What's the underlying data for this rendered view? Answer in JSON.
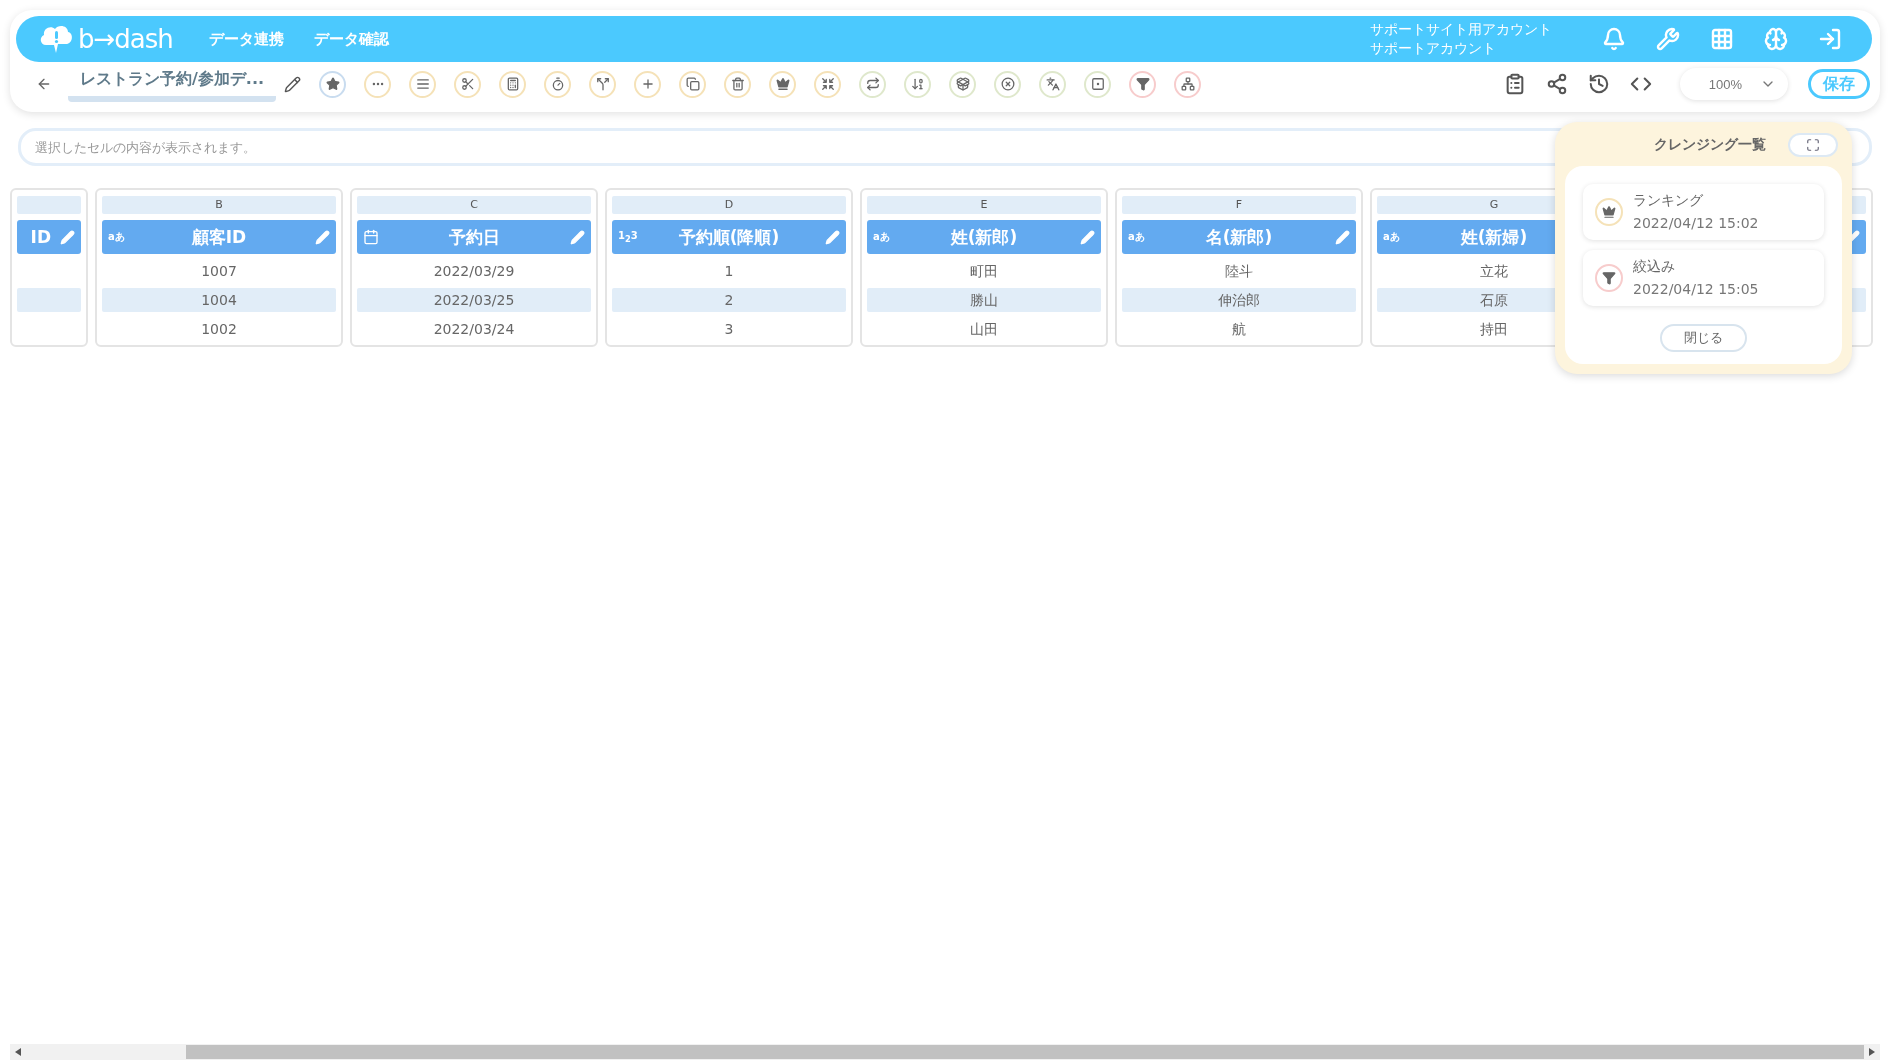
{
  "header": {
    "logo": "b→dash",
    "nav": [
      "データ連携",
      "データ確認"
    ],
    "account": {
      "site": "サポートサイト用アカウント",
      "name": "サポートアカウント"
    },
    "icons": [
      {
        "kind": "bell"
      },
      {
        "kind": "wrench"
      },
      {
        "kind": "grid"
      },
      {
        "kind": "mascot"
      },
      {
        "kind": "logout"
      }
    ]
  },
  "toolbar": {
    "title": "レストラン予約/参加デ...",
    "tools": [
      {
        "kind": "star",
        "color": "#c9dcef"
      },
      {
        "kind": "dots",
        "color": "#f5e2b8"
      },
      {
        "kind": "lines",
        "color": "#f5e2b8"
      },
      {
        "kind": "scissors",
        "color": "#f5e2b8"
      },
      {
        "kind": "calc",
        "color": "#f5e2b8"
      },
      {
        "kind": "timer",
        "color": "#f5e2b8"
      },
      {
        "kind": "split",
        "color": "#f5e2b8"
      },
      {
        "kind": "plus",
        "color": "#f5e2b8"
      },
      {
        "kind": "copy",
        "color": "#f5e2b8"
      },
      {
        "kind": "trash",
        "color": "#f5e2b8"
      },
      {
        "kind": "crown",
        "color": "#f5e2b8"
      },
      {
        "kind": "shrink",
        "color": "#f5e2b8"
      },
      {
        "kind": "repeat",
        "color": "#dfe8cc"
      },
      {
        "kind": "order",
        "color": "#dfe8cc"
      },
      {
        "kind": "box",
        "color": "#dfe8cc"
      },
      {
        "kind": "xcircle",
        "color": "#dfe8cc"
      },
      {
        "kind": "translate",
        "color": "#dfe8cc"
      },
      {
        "kind": "zero",
        "color": "#dfe8cc"
      },
      {
        "kind": "filter",
        "color": "#f7cccc"
      },
      {
        "kind": "network",
        "color": "#f7cccc"
      }
    ],
    "actions": [
      {
        "kind": "clipboard"
      },
      {
        "kind": "share"
      },
      {
        "kind": "history"
      },
      {
        "kind": "code"
      }
    ],
    "zoom": "100%",
    "save": "保存"
  },
  "cell_field": {
    "placeholder": "選択したセルの内容が表示されます。"
  },
  "columns": [
    {
      "name": "ID",
      "kind": "none"
    },
    {
      "letter": "B",
      "name": "顧客ID",
      "kind": "text",
      "type_label": "aあ",
      "cells": [
        "1007",
        "1004",
        "1002"
      ]
    },
    {
      "letter": "C",
      "name": "予約日",
      "kind": "date",
      "cells": [
        "2022/03/29",
        "2022/03/25",
        "2022/03/24"
      ]
    },
    {
      "letter": "D",
      "name": "予約順(降順)",
      "kind": "number",
      "type_label": "1$_{2}$3",
      "cells": [
        "1",
        "2",
        "3"
      ]
    },
    {
      "letter": "E",
      "name": "姓(新郎)",
      "kind": "text",
      "type_label": "aあ",
      "cells": [
        "町田",
        "勝山",
        "山田"
      ]
    },
    {
      "letter": "F",
      "name": "名(新郎)",
      "kind": "text",
      "type_label": "aあ",
      "cells": [
        "陸斗",
        "伸治郎",
        "航"
      ]
    },
    {
      "letter": "G",
      "name": "姓(新婦)",
      "kind": "text",
      "type_label": "aあ",
      "edit_icon": false,
      "cells": [
        "立花",
        "石原",
        "持田"
      ]
    },
    {
      "kind": "none"
    }
  ],
  "cleansing_panel": {
    "title": "クレンジング一覧",
    "items": [
      {
        "kind": "crown",
        "color": "#f5e2b8",
        "name": "ランキング",
        "time": "2022/04/12 15:02"
      },
      {
        "kind": "filter",
        "color": "#f7cccc",
        "name": "絞込み",
        "time": "2022/04/12 15:05"
      }
    ],
    "close": "閉じる"
  }
}
